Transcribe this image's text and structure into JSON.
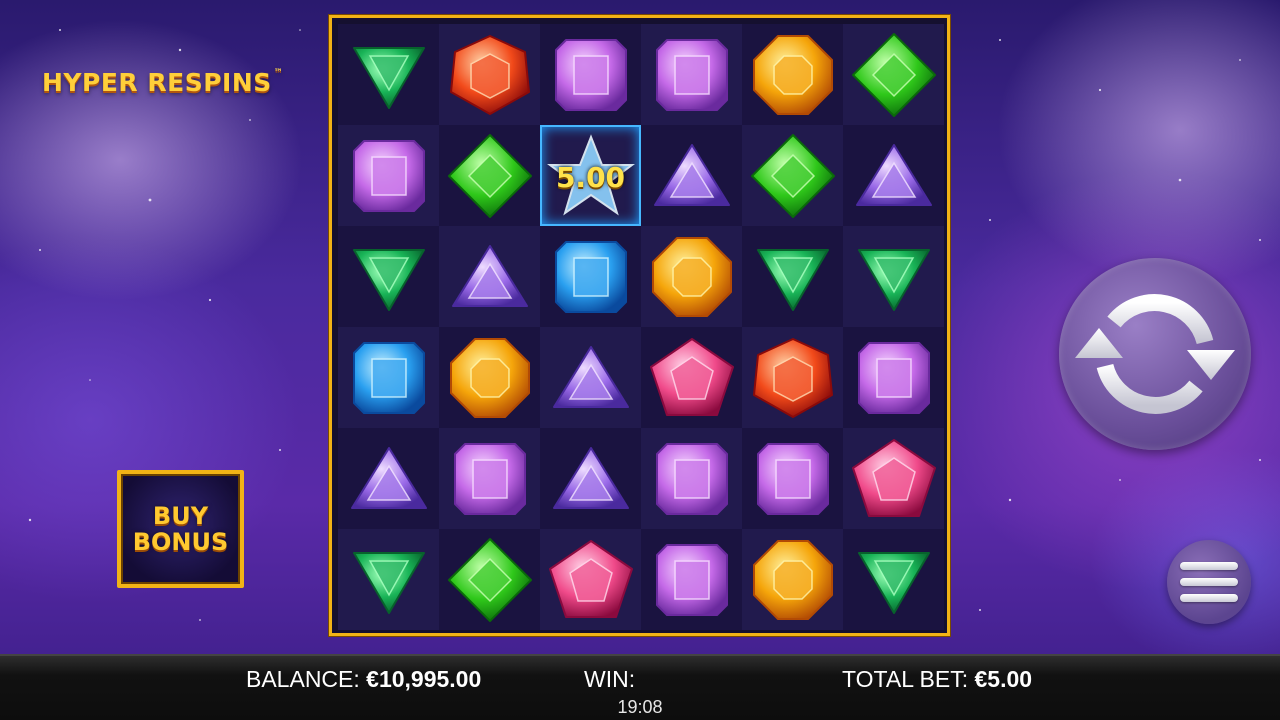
{
  "game": {
    "logo_text": "HYPER RESPINS",
    "logo_trademark": "™"
  },
  "buy_bonus": {
    "line1": "BUY",
    "line2": "BONUS"
  },
  "grid": {
    "rows": [
      [
        "green-triangle-gem",
        "red-hexagon-gem",
        "purple-square-gem",
        "purple-square-gem",
        "yellow-octagon-gem",
        "green-diamond-gem"
      ],
      [
        "purple-square-gem",
        "green-diamond-gem",
        "blue-star-bonus",
        "purple-triangle-gem",
        "green-diamond-gem",
        "purple-triangle-gem"
      ],
      [
        "green-triangle-gem",
        "purple-triangle-gem",
        "blue-square-gem",
        "yellow-octagon-gem",
        "green-triangle-gem",
        "green-triangle-gem"
      ],
      [
        "blue-square-gem",
        "yellow-octagon-gem",
        "purple-triangle-gem",
        "pink-pentagon-gem",
        "red-hexagon-gem",
        "purple-square-gem"
      ],
      [
        "purple-triangle-gem",
        "purple-square-gem",
        "purple-triangle-gem",
        "purple-square-gem",
        "purple-square-gem",
        "pink-pentagon-gem"
      ],
      [
        "green-triangle-gem",
        "green-diamond-gem",
        "pink-pentagon-gem",
        "purple-square-gem",
        "yellow-octagon-gem",
        "green-triangle-gem"
      ]
    ],
    "bonus_value": "5.00"
  },
  "bottom_bar": {
    "balance_label": "BALANCE:",
    "balance_value": "€10,995.00",
    "win_label": "WIN:",
    "win_value": "",
    "total_bet_label": "TOTAL BET:",
    "total_bet_value": "€5.00",
    "clock": "19:08"
  },
  "icons": {
    "spin": "spin-arrows-icon",
    "menu": "hamburger-menu-icon"
  },
  "colors": {
    "frame_gold": "#f2b316",
    "logo_gold": "#ffcf3a",
    "bonus_value": "#ffe24a"
  }
}
